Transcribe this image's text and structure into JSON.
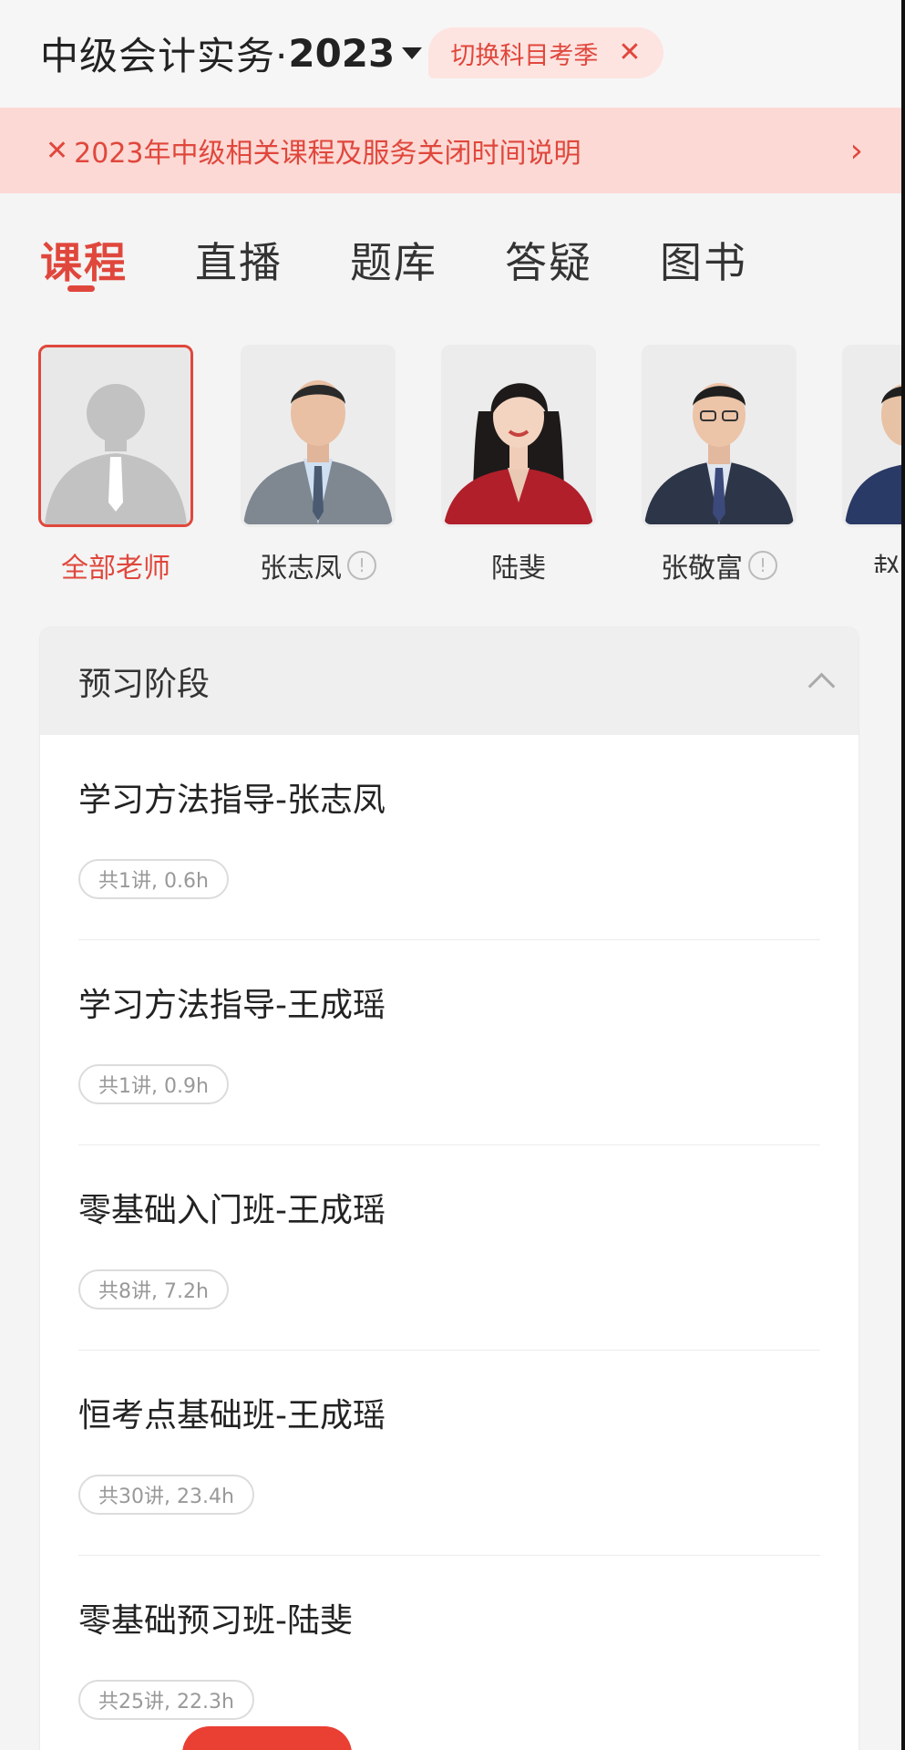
{
  "header": {
    "subject": "中级会计实务·",
    "year": "2023",
    "switch_label": "切换科目考季"
  },
  "notice": {
    "text": "2023年中级相关课程及服务关闭时间说明"
  },
  "tabs": [
    {
      "label": "课程",
      "active": true
    },
    {
      "label": "直播"
    },
    {
      "label": "题库"
    },
    {
      "label": "答疑"
    },
    {
      "label": "图书"
    }
  ],
  "teachers": [
    {
      "name": "全部老师",
      "selected": true
    },
    {
      "name": "张志凤",
      "info": true
    },
    {
      "name": "陆斐"
    },
    {
      "name": "张敬富",
      "info": true
    },
    {
      "name": "赵"
    }
  ],
  "section": {
    "title": "预习阶段",
    "courses": [
      {
        "title": "学习方法指导-张志凤",
        "meta": "共1讲, 0.6h"
      },
      {
        "title": "学习方法指导-王成瑶",
        "meta": "共1讲, 0.9h"
      },
      {
        "title": "零基础入门班-王成瑶",
        "meta": "共8讲, 7.2h"
      },
      {
        "title": "恒考点基础班-王成瑶",
        "meta": "共30讲, 23.4h"
      },
      {
        "title": "零基础预习班-陆斐",
        "meta": "共25讲, 22.3h"
      }
    ]
  },
  "colors": {
    "accent": "#e0473c",
    "notice_bg": "#fcd9d5"
  }
}
